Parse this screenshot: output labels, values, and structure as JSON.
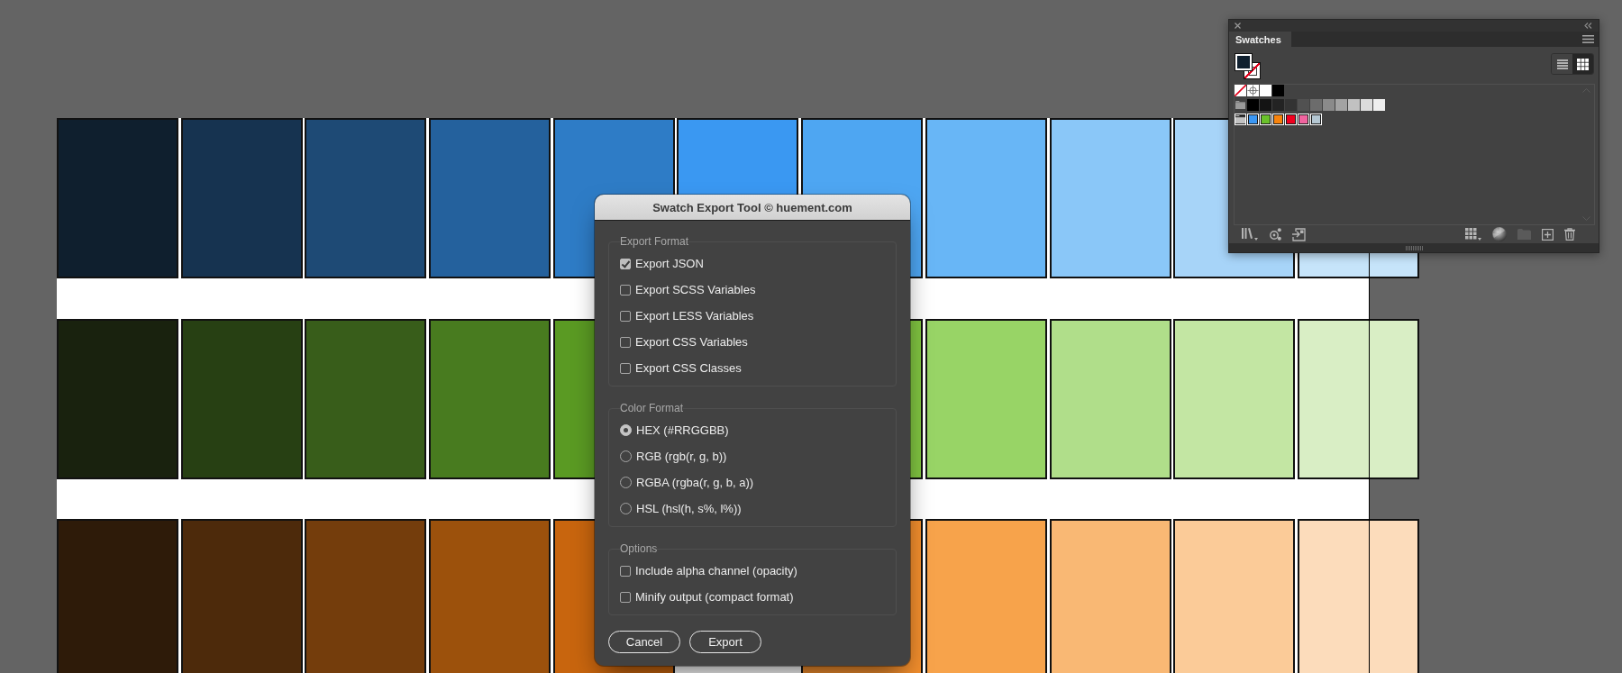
{
  "artboard": {
    "rows": [
      {
        "tiles": [
          {
            "kind": "tile",
            "color": "#0f1f2e"
          },
          {
            "kind": "tile",
            "color": "#163350"
          },
          {
            "kind": "tile",
            "color": "#1e4a75"
          },
          {
            "kind": "tile",
            "color": "#24619d"
          },
          {
            "kind": "tile",
            "color": "#2e7cc6"
          },
          {
            "kind": "tile",
            "color": "#3a98f2"
          },
          {
            "kind": "tile",
            "color": "#4ea6f2"
          },
          {
            "kind": "tile",
            "color": "#68b6f6"
          },
          {
            "kind": "tile",
            "color": "#8ac7f8"
          },
          {
            "kind": "tile",
            "color": "#a7d4f8"
          },
          {
            "kind": "tile",
            "color": "#c6e4fa"
          }
        ]
      },
      {
        "tiles": [
          {
            "kind": "tile",
            "color": "#19220e"
          },
          {
            "kind": "tile",
            "color": "#274013"
          },
          {
            "kind": "tile",
            "color": "#385d1a"
          },
          {
            "kind": "tile",
            "color": "#487b1f"
          },
          {
            "kind": "tile",
            "color": "#5a9a23"
          },
          {
            "kind": "covered"
          },
          {
            "kind": "tile",
            "color": "#80c441"
          },
          {
            "kind": "tile",
            "color": "#98d466"
          },
          {
            "kind": "tile",
            "color": "#b0de8a"
          },
          {
            "kind": "tile",
            "color": "#c3e6a3"
          },
          {
            "kind": "tile",
            "color": "#d9eec5"
          }
        ]
      },
      {
        "tiles": [
          {
            "kind": "tile",
            "color": "#2e1b09"
          },
          {
            "kind": "tile",
            "color": "#4d2a0b"
          },
          {
            "kind": "tile",
            "color": "#743d0c"
          },
          {
            "kind": "tile",
            "color": "#9c510c"
          },
          {
            "kind": "tile",
            "color": "#c8650e"
          },
          {
            "kind": "covered"
          },
          {
            "kind": "tile",
            "color": "#f28e2d"
          },
          {
            "kind": "tile",
            "color": "#f7a34b"
          },
          {
            "kind": "tile",
            "color": "#f9b874"
          },
          {
            "kind": "tile",
            "color": "#fbcb98"
          },
          {
            "kind": "tile",
            "color": "#fcdcbb"
          }
        ]
      }
    ]
  },
  "swatches_panel": {
    "tabs": [
      {
        "label": "Swatches",
        "selected": true
      }
    ],
    "fill_stroke": {
      "fill": {
        "color": "#10202f"
      },
      "stroke": {
        "kind": "none"
      }
    },
    "view_modes": [
      {
        "kind": "list",
        "selected": false
      },
      {
        "kind": "grid",
        "selected": true
      }
    ],
    "swatch_groups": [
      {
        "kind": "basic",
        "selected": false,
        "swatches": [
          {
            "kind": "none"
          },
          {
            "kind": "registration"
          },
          {
            "kind": "color",
            "color": "#ffffff"
          },
          {
            "kind": "color",
            "color": "#000000"
          }
        ]
      },
      {
        "kind": "folder",
        "selected": false,
        "swatches": [
          {
            "kind": "color",
            "color": "#000000"
          },
          {
            "kind": "color",
            "color": "#141414"
          },
          {
            "kind": "color",
            "color": "#232323"
          },
          {
            "kind": "color",
            "color": "#333333"
          },
          {
            "kind": "color",
            "color": "#515151"
          },
          {
            "kind": "color",
            "color": "#6c6c6c"
          },
          {
            "kind": "color",
            "color": "#8a8a8a"
          },
          {
            "kind": "color",
            "color": "#a3a3a3"
          },
          {
            "kind": "color",
            "color": "#c1c1c1"
          },
          {
            "kind": "color",
            "color": "#dcdcdc"
          },
          {
            "kind": "color",
            "color": "#eeeeee"
          }
        ]
      },
      {
        "kind": "folder",
        "selected": true,
        "swatches": [
          {
            "kind": "color",
            "color": "#3b97f3"
          },
          {
            "kind": "color",
            "color": "#6ac12b"
          },
          {
            "kind": "color",
            "color": "#f7830d"
          },
          {
            "kind": "color",
            "color": "#f0001f"
          },
          {
            "kind": "color",
            "color": "#f0649f"
          },
          {
            "kind": "color",
            "color": "#b4c7d2"
          }
        ]
      }
    ],
    "toolbar": {
      "left": [
        {
          "kind": "library",
          "disabled": false
        },
        {
          "kind": "swatch_kinds",
          "disabled": false
        },
        {
          "kind": "import",
          "disabled": false
        }
      ],
      "right": [
        {
          "kind": "color_group",
          "disabled": false
        },
        {
          "kind": "swatch_options",
          "disabled": false
        },
        {
          "kind": "new_group",
          "disabled": true
        },
        {
          "kind": "new_swatch",
          "disabled": false
        },
        {
          "kind": "delete",
          "disabled": false
        }
      ]
    }
  },
  "dialog": {
    "title": "Swatch Export Tool © huement.com",
    "groups": [
      {
        "legend": "Export Format",
        "kind": "checkbox",
        "items": [
          {
            "label": "Export JSON",
            "checked": true
          },
          {
            "label": "Export SCSS Variables",
            "checked": false
          },
          {
            "label": "Export LESS Variables",
            "checked": false
          },
          {
            "label": "Export CSS Variables",
            "checked": false
          },
          {
            "label": "Export CSS Classes",
            "checked": false
          }
        ]
      },
      {
        "legend": "Color Format",
        "kind": "radio",
        "items": [
          {
            "label": "HEX (#RRGGBB)",
            "selected": true
          },
          {
            "label": "RGB (rgb(r, g, b))",
            "selected": false
          },
          {
            "label": "RGBA (rgba(r, g, b, a))",
            "selected": false
          },
          {
            "label": "HSL (hsl(h, s%, l%))",
            "selected": false
          }
        ]
      },
      {
        "legend": "Options",
        "kind": "checkbox",
        "items": [
          {
            "label": "Include alpha channel (opacity)",
            "checked": false
          },
          {
            "label": "Minify output (compact format)",
            "checked": false
          }
        ]
      }
    ],
    "buttons": [
      "Cancel",
      "Export"
    ]
  }
}
